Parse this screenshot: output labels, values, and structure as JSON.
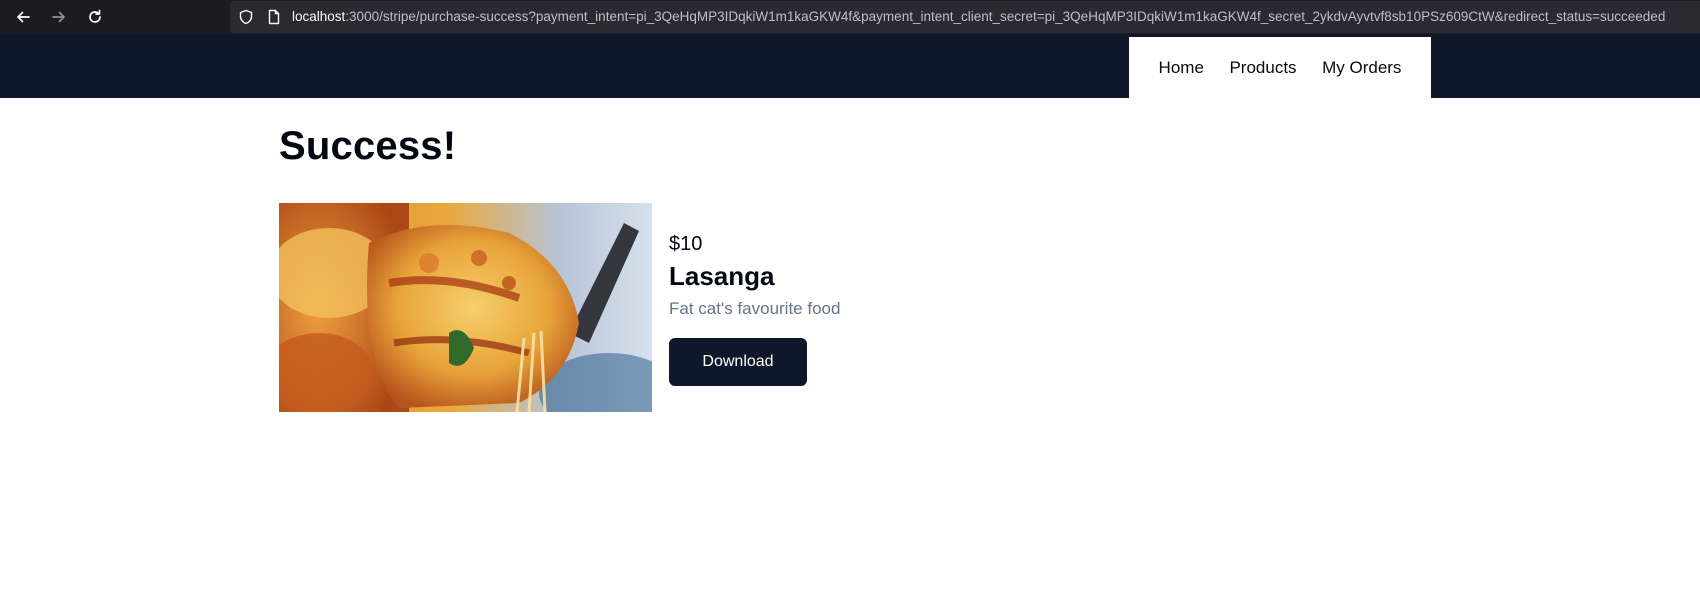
{
  "browser": {
    "url_host": "localhost",
    "url_rest": ":3000/stripe/purchase-success?payment_intent=pi_3QeHqMP3IDqkiW1m1kaGKW4f&payment_intent_client_secret=pi_3QeHqMP3IDqkiW1m1kaGKW4f_secret_2ykdvAyvtvf8sb10PSz609CtW&redirect_status=succeeded"
  },
  "nav": {
    "links": [
      {
        "label": "Home"
      },
      {
        "label": "Products"
      },
      {
        "label": "My Orders"
      }
    ]
  },
  "page": {
    "title": "Success!"
  },
  "product": {
    "price": "$10",
    "name": "Lasanga",
    "description": "Fat cat's favourite food",
    "download_label": "Download"
  },
  "colors": {
    "header_bg": "#0f172a",
    "button_bg": "#0f172a",
    "description": "#64748b"
  }
}
